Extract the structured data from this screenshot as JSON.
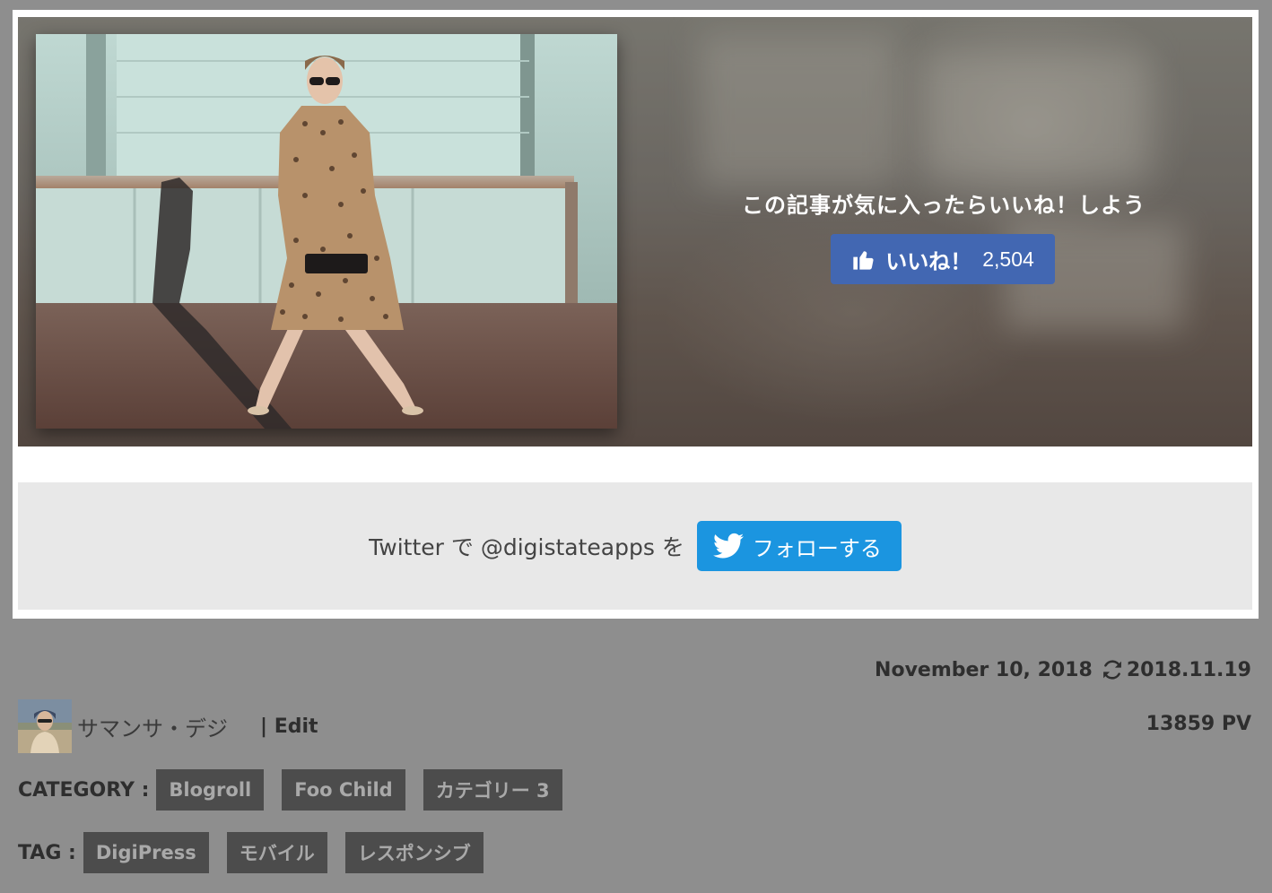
{
  "hero": {
    "like_prompt": "この記事が気に入ったらいいね！しよう",
    "like_button_label": "いいね！",
    "like_count": "2,504",
    "like_color": "#4267b2"
  },
  "follow": {
    "text_prefix": "Twitter で ",
    "handle": "@digistateapps",
    "text_suffix": " を",
    "button_label": "フォローする",
    "button_color": "#1b95e0"
  },
  "meta": {
    "published_date": "November 10, 2018",
    "updated_date": "2018.11.19",
    "pageviews": "13859 PV",
    "author_name": "サマンサ・デジ",
    "edit_label": "| Edit"
  },
  "category": {
    "label": "CATEGORY :",
    "items": [
      "Blogroll",
      "Foo Child",
      "カテゴリー 3"
    ]
  },
  "tag": {
    "label": "TAG :",
    "items": [
      "DigiPress",
      "モバイル",
      "レスポンシブ"
    ]
  },
  "icons": {
    "like": "thumbs-up-icon",
    "follow": "twitter-bird-icon",
    "updated": "refresh-icon"
  }
}
